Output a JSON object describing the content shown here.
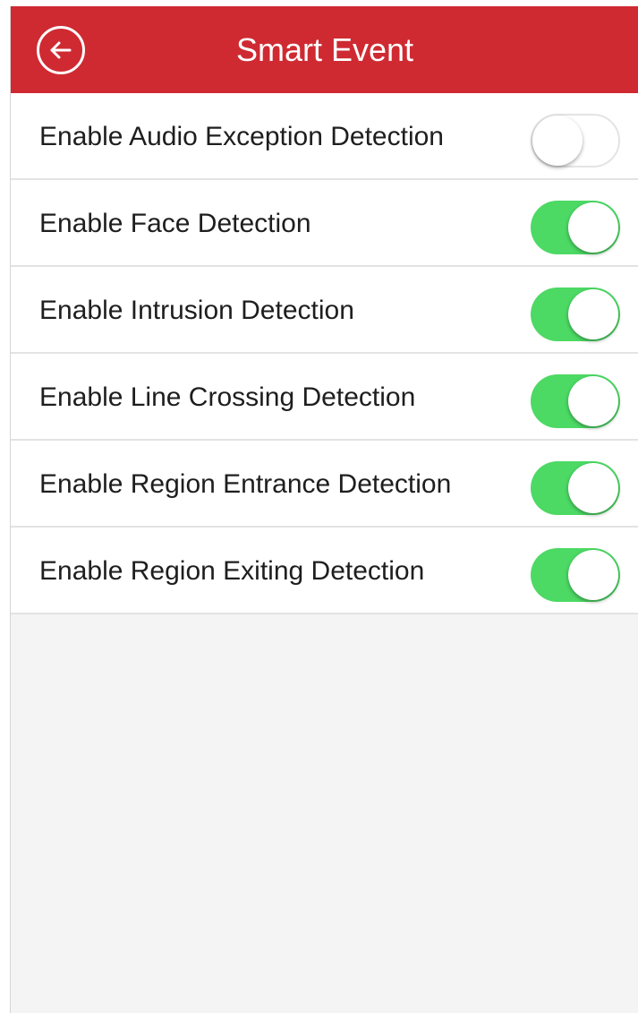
{
  "header": {
    "title": "Smart Event",
    "back_icon": "back-arrow-circle-icon",
    "color": "#cf2a32"
  },
  "toggle_on_color": "#4cd964",
  "settings": [
    {
      "label": "Enable Audio Exception Detection",
      "enabled": false
    },
    {
      "label": "Enable Face Detection",
      "enabled": true
    },
    {
      "label": "Enable Intrusion Detection",
      "enabled": true
    },
    {
      "label": "Enable Line Crossing Detection",
      "enabled": true
    },
    {
      "label": "Enable Region Entrance Detection",
      "enabled": true
    },
    {
      "label": "Enable Region Exiting Detection",
      "enabled": true
    }
  ]
}
